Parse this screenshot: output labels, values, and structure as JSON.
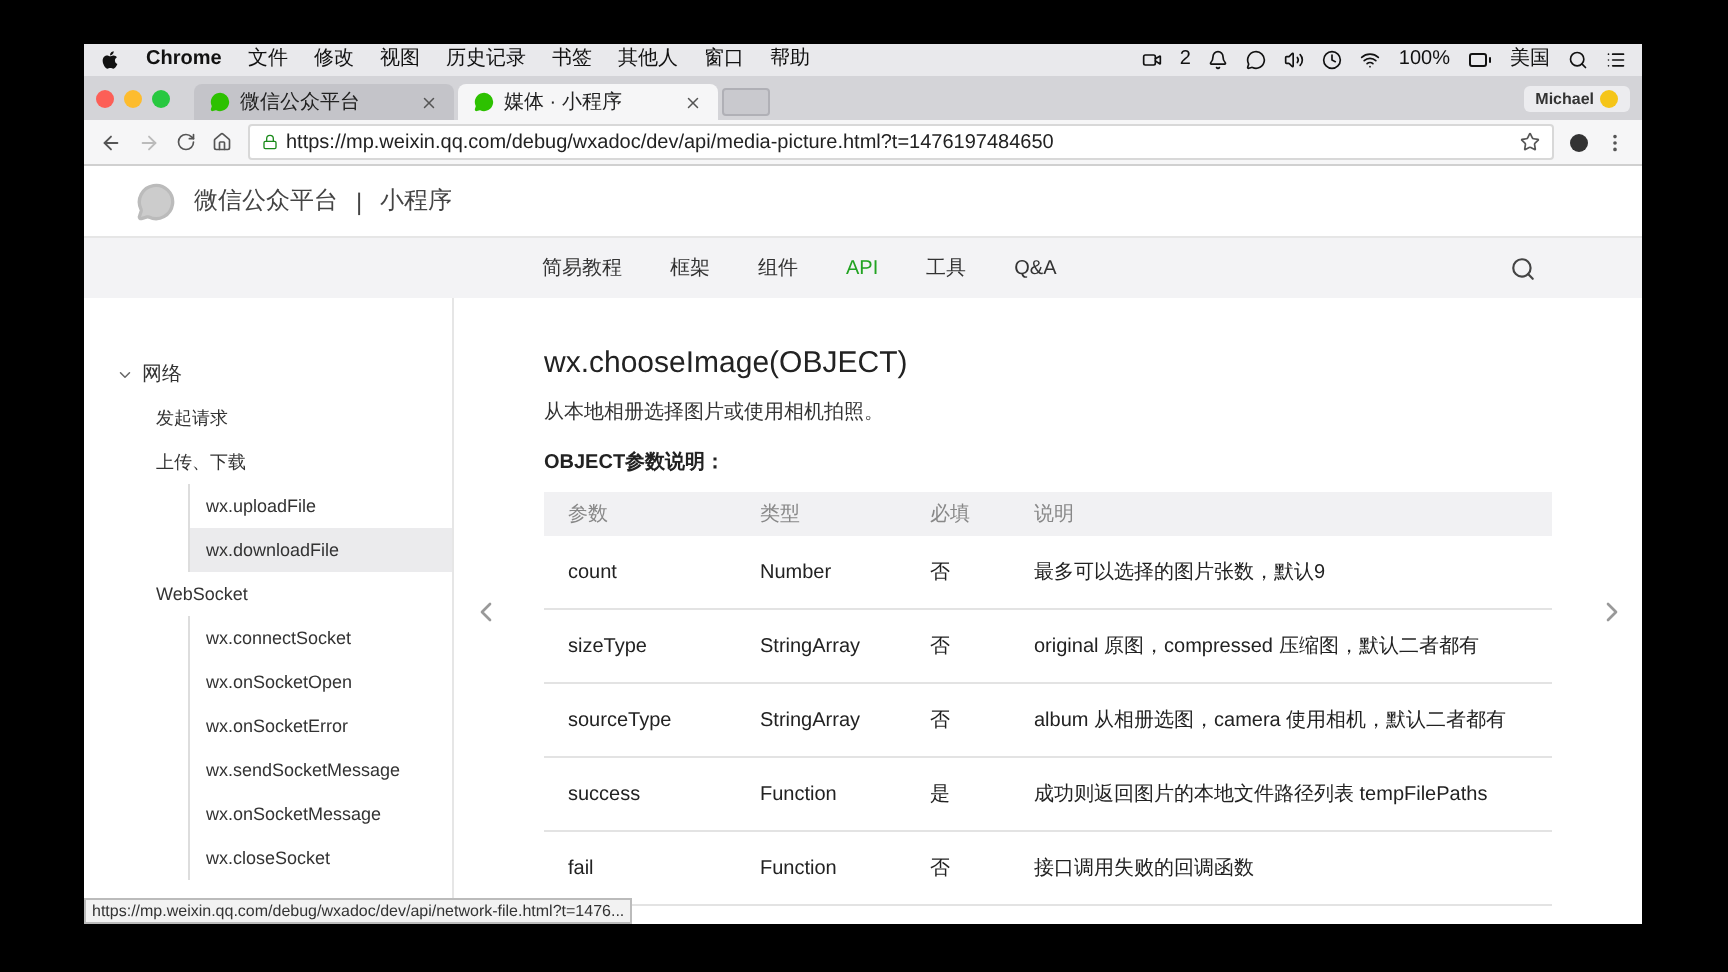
{
  "menu_bar": {
    "app": "Chrome",
    "items": [
      "文件",
      "修改",
      "视图",
      "历史记录",
      "书签",
      "其他人",
      "窗口",
      "帮助"
    ],
    "status": {
      "badge_count": "2",
      "battery": "100%",
      "input_source": "美国"
    }
  },
  "tabs": [
    {
      "label": "微信公众平台",
      "selected": false
    },
    {
      "label": "媒体 · 小程序",
      "selected": true
    }
  ],
  "profile": "Michael",
  "address_bar": {
    "url": "https://mp.weixin.qq.com/debug/wxadoc/dev/api/media-picture.html?t=1476197484650"
  },
  "site_header": {
    "brand": "微信公众平台",
    "separator": "|",
    "product": "小程序"
  },
  "nav": [
    {
      "label": "简易教程",
      "selected": false
    },
    {
      "label": "框架",
      "selected": false
    },
    {
      "label": "组件",
      "selected": false
    },
    {
      "label": "API",
      "selected": true
    },
    {
      "label": "工具",
      "selected": false
    },
    {
      "label": "Q&A",
      "selected": false
    }
  ],
  "sidebar": {
    "items": [
      {
        "label": "网络",
        "expanded": true,
        "selected": false,
        "children": [
          {
            "label": "发起请求",
            "selected": false
          },
          {
            "label": "上传、下载",
            "selected": false,
            "children": [
              {
                "label": "wx.uploadFile",
                "selected": false
              },
              {
                "label": "wx.downloadFile",
                "selected": true
              }
            ]
          },
          {
            "label": "WebSocket",
            "selected": false,
            "children": [
              {
                "label": "wx.connectSocket",
                "selected": false
              },
              {
                "label": "wx.onSocketOpen",
                "selected": false
              },
              {
                "label": "wx.onSocketError",
                "selected": false
              },
              {
                "label": "wx.sendSocketMessage",
                "selected": false
              },
              {
                "label": "wx.onSocketMessage",
                "selected": false
              },
              {
                "label": "wx.closeSocket",
                "selected": false
              }
            ]
          }
        ]
      }
    ]
  },
  "article": {
    "title": "wx.chooseImage(OBJECT)",
    "description": "从本地相册选择图片或使用相机拍照。",
    "params_heading": "OBJECT参数说明：",
    "table": {
      "columns": [
        "参数",
        "类型",
        "必填",
        "说明"
      ],
      "rows": [
        [
          "count",
          "Number",
          "否",
          "最多可以选择的图片张数，默认9"
        ],
        [
          "sizeType",
          "StringArray",
          "否",
          "original 原图，compressed 压缩图，默认二者都有"
        ],
        [
          "sourceType",
          "StringArray",
          "否",
          "album 从相册选图，camera 使用相机，默认二者都有"
        ],
        [
          "success",
          "Function",
          "是",
          "成功则返回图片的本地文件路径列表 tempFilePaths"
        ],
        [
          "fail",
          "Function",
          "否",
          "接口调用失败的回调函数"
        ]
      ]
    }
  },
  "status_bar": {
    "link_preview": "https://mp.weixin.qq.com/debug/wxadoc/dev/api/network-file.html?t=1476..."
  }
}
